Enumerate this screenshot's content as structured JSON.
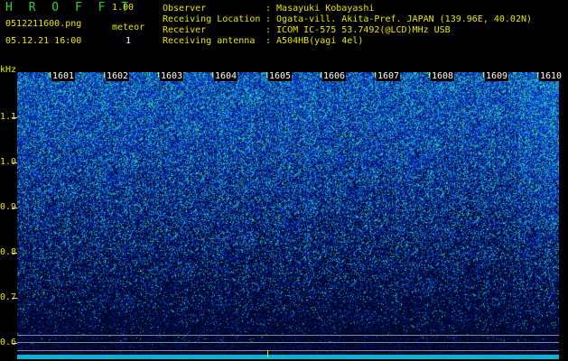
{
  "header": {
    "app_name": "H R O F F T",
    "version": "1.00",
    "file_name": "0512211600.png",
    "meteor_label": "meteor",
    "meteor_count": "1",
    "datetime": "05.12.21 16:00"
  },
  "station": {
    "observer_label": "Observer",
    "observer_value": ": Masayuki Kobayashi",
    "location_label": "Receiving Location",
    "location_value": ": Ogata-vill. Akita-Pref. JAPAN (139.96E, 40.02N)",
    "receiver_label": "Receiver",
    "receiver_value": ": ICOM IC-575 53.7492(@LCD)MHz USB",
    "antenna_label": "Receiving antenna",
    "antenna_value": ": A504HB(yagi 4el)"
  },
  "axis": {
    "y_unit": "kHz",
    "y_ticks": [
      "1.1",
      "1.0",
      "0.9",
      "0.8",
      "0.7",
      "0.6"
    ],
    "x_ticks": [
      "1601",
      "1602",
      "1603",
      "1604",
      "1605",
      "1606",
      "1607",
      "1608",
      "1609",
      "1610"
    ]
  },
  "colors": {
    "label_yellow": "#e8e800",
    "title_green": "#33cc33",
    "spectrum_cyan": "#00e5ff"
  }
}
